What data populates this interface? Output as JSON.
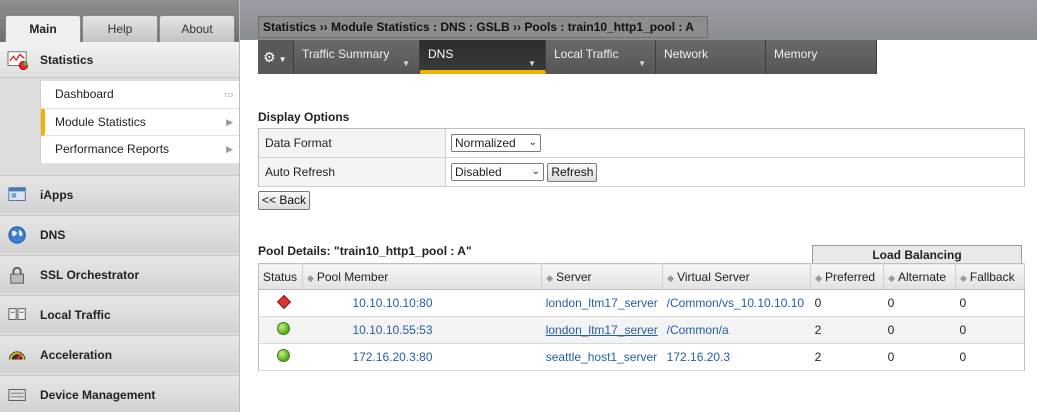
{
  "tabs": [
    "Main",
    "Help",
    "About"
  ],
  "sidebar": {
    "statistics_label": "Statistics",
    "submenu": [
      {
        "label": "Dashboard"
      },
      {
        "label": "Module Statistics"
      },
      {
        "label": "Performance Reports"
      }
    ],
    "sections": [
      {
        "label": "iApps",
        "icon": "iapps-icon"
      },
      {
        "label": "DNS",
        "icon": "globe-icon"
      },
      {
        "label": "SSL Orchestrator",
        "icon": "lock-icon"
      },
      {
        "label": "Local Traffic",
        "icon": "local-traffic-icon"
      },
      {
        "label": "Acceleration",
        "icon": "gauge-icon"
      },
      {
        "label": "Device Management",
        "icon": "device-icon"
      }
    ]
  },
  "breadcrumb": "Statistics  ››  Module Statistics : DNS : GSLB  ››  Pools : train10_http1_pool : A",
  "navbar": {
    "items": [
      "Traffic Summary",
      "DNS",
      "Local Traffic",
      "Network",
      "Memory"
    ],
    "active": "DNS"
  },
  "display_options": {
    "title": "Display Options",
    "data_format_label": "Data Format",
    "data_format_value": "Normalized",
    "auto_refresh_label": "Auto Refresh",
    "auto_refresh_value": "Disabled",
    "refresh_button": "Refresh"
  },
  "back_button": "<< Back",
  "pool": {
    "title": "Pool Details: \"train10_http1_pool : A\"",
    "group_header": "Load Balancing",
    "columns": [
      "Status",
      "Pool Member",
      "Server",
      "Virtual Server",
      "Preferred",
      "Alternate",
      "Fallback"
    ],
    "rows": [
      {
        "status": "error",
        "member": "10.10.10.10:80",
        "server": "london_ltm17_server",
        "virtual_server": "/Common/vs_10.10.10.10",
        "preferred": "0",
        "alternate": "0",
        "fallback": "0"
      },
      {
        "status": "ok",
        "member": "10.10.10.55:53",
        "server": "london_ltm17_server",
        "virtual_server": "/Common/a",
        "preferred": "2",
        "alternate": "0",
        "fallback": "0"
      },
      {
        "status": "ok",
        "member": "172.16.20.3:80",
        "server": "seattle_host1_server",
        "virtual_server": "172.16.20.3",
        "preferred": "2",
        "alternate": "0",
        "fallback": "0"
      }
    ]
  },
  "colors": {
    "accent": "#f0b400",
    "link": "#245ea8",
    "nav_bg": "#595959"
  }
}
